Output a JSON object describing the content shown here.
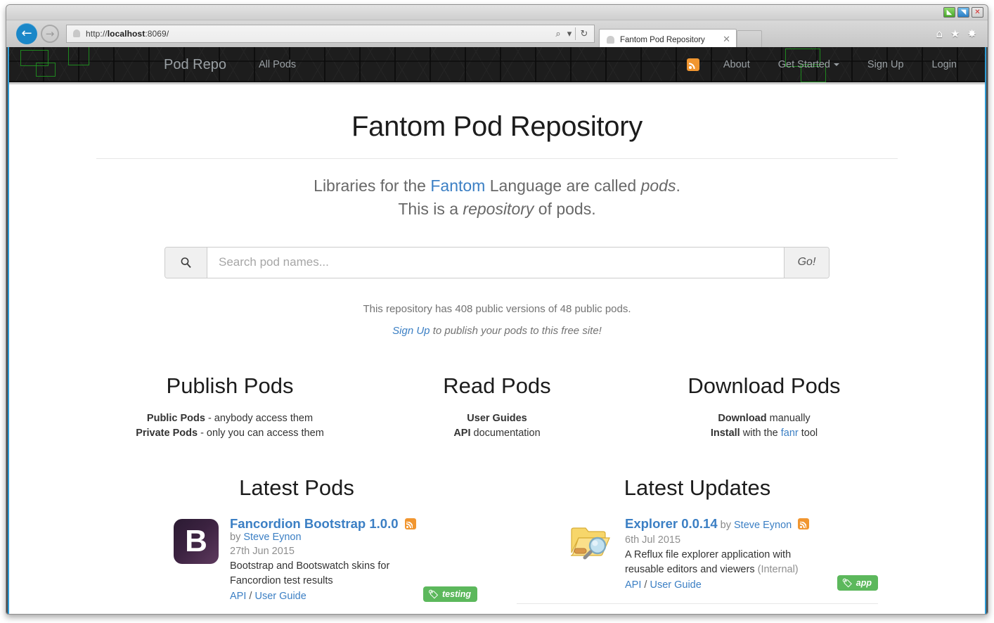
{
  "window": {
    "buttons": [
      {
        "name": "minimize",
        "glyph": "◣",
        "color": "#47a52a"
      },
      {
        "name": "maximize",
        "glyph": "◥",
        "color": "#2b7fc4"
      },
      {
        "name": "close",
        "glyph": "✕",
        "color": "#d62a2a"
      }
    ]
  },
  "browser": {
    "back_glyph": "←",
    "forward_glyph": "→",
    "url_prefix": "http://",
    "url_host": "localhost",
    "url_suffix": ":8069/",
    "url_full": "http://localhost:8069/",
    "search_glyph": "⌕",
    "dropdown_glyph": "▾",
    "reload_glyph": "↻",
    "tab_title": "Fantom Pod Repository",
    "tab_close_glyph": "✕",
    "home_glyph": "⌂",
    "favorites_glyph": "★",
    "settings_glyph": "✸"
  },
  "navbar": {
    "brand": "Pod Repo",
    "left_links": [
      {
        "label": "All Pods"
      }
    ],
    "right_links": [
      {
        "label": "About",
        "caret": false
      },
      {
        "label": "Get Started",
        "caret": true
      },
      {
        "label": "Sign Up",
        "caret": false
      },
      {
        "label": "Login",
        "caret": false
      }
    ],
    "rss_icon": "rss-icon",
    "logo_icon": "fantom-ghost-logo"
  },
  "hero": {
    "title": "Fantom Pod Repository",
    "lede_1_pre": "Libraries for the ",
    "lede_1_link": "Fantom",
    "lede_1_mid": " Language are called ",
    "lede_1_em": "pods",
    "lede_1_post": ".",
    "lede_2_pre": "This is a ",
    "lede_2_em": "repository",
    "lede_2_post": " of pods."
  },
  "search": {
    "placeholder": "Search pod names...",
    "value": "",
    "go_label": "Go!",
    "icon": "search-icon"
  },
  "stats": {
    "line": "This repository has 408 public versions of 48 public pods.",
    "versions_count": "408",
    "pods_count": "48",
    "signup_link": "Sign Up",
    "signup_rest": " to publish your pods to this free site!"
  },
  "features": [
    {
      "title": "Publish Pods",
      "lines": [
        {
          "bold": "Public Pods",
          "rest": " - anybody access them"
        },
        {
          "bold": "Private Pods",
          "rest": " - only you can access them"
        }
      ]
    },
    {
      "title": "Read Pods",
      "lines": [
        {
          "bold": "User Guides",
          "rest": ""
        },
        {
          "bold": "API",
          "rest": " documentation"
        }
      ]
    },
    {
      "title": "Download Pods",
      "lines": [
        {
          "bold": "Download",
          "rest": " manually"
        },
        {
          "bold": "Install",
          "rest": " with the ",
          "link": "fanr",
          "tail": " tool"
        }
      ]
    }
  ],
  "latest_pods": {
    "title": "Latest Pods",
    "entry": {
      "icon": "bootstrap-icon",
      "icon_letter": "B",
      "name": "Fancordion Bootstrap 1.0.0",
      "by_prefix": "by ",
      "author": "Steve Eynon",
      "date": "27th Jun 2015",
      "description": "Bootstrap and Bootswatch skins for Fancordion test results",
      "link_api": "API",
      "link_sep": " / ",
      "link_guide": "User Guide",
      "badge": "testing",
      "rss_icon": "rss-icon"
    }
  },
  "latest_updates": {
    "title": "Latest Updates",
    "entry": {
      "icon": "folder-search-icon",
      "name": "Explorer 0.0.14",
      "by_prefix": " by ",
      "author": "Steve Eynon",
      "date": "6th Jul 2015",
      "description": "A Reflux file explorer application with reusable editors and viewers ",
      "description_muted": "(Internal)",
      "link_api": "API",
      "link_sep": " / ",
      "link_guide": "User Guide",
      "badge": "app",
      "rss_icon": "rss-icon"
    }
  },
  "colors": {
    "link": "#3b7fc4",
    "badge_green": "#5cb85c",
    "rss_orange": "#f19630",
    "navbar_dark": "#1d1d1d",
    "accent_blue": "#2e9bd4"
  }
}
